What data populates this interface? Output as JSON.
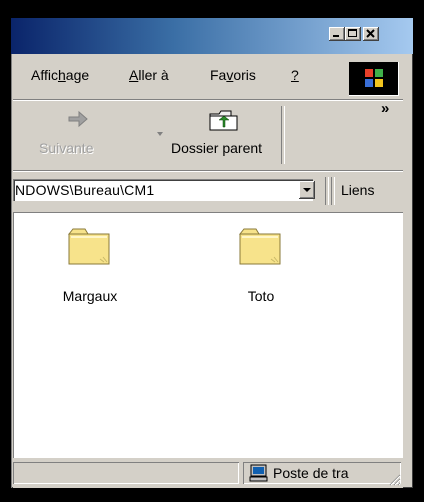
{
  "menu": {
    "items": [
      {
        "label": "Affic",
        "accel": "h",
        "rest": "age"
      },
      {
        "label": "",
        "accel": "A",
        "rest": "ller à"
      },
      {
        "label": "Fa",
        "accel": "v",
        "rest": "oris"
      },
      {
        "label": "",
        "accel": "?",
        "rest": ""
      }
    ]
  },
  "toolbar": {
    "forward_label": "Suivante",
    "up_label": "Dossier parent",
    "more": "»"
  },
  "address": {
    "path": "NDOWS\\Bureau\\CM1",
    "links_label": "Liens"
  },
  "folders": [
    {
      "name": "Margaux"
    },
    {
      "name": "Toto"
    }
  ],
  "status": {
    "zone": "Poste de tra"
  },
  "colors": {
    "title_start": "#0a246a",
    "title_end": "#a6caf0",
    "chrome": "#d4d0c8",
    "folder_fill": "#f7e38b"
  }
}
